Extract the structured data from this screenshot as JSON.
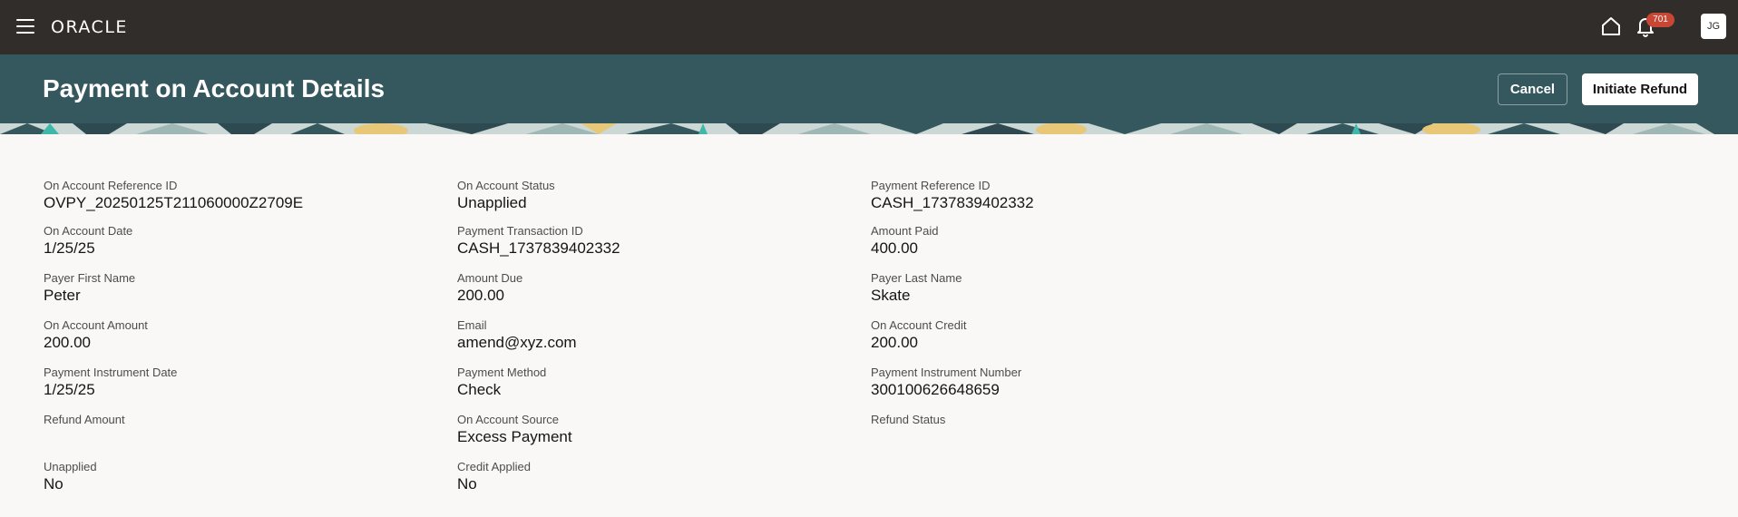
{
  "topbar": {
    "logo": "ORACLE",
    "notification_count": "701",
    "avatar_initials": "JG"
  },
  "header": {
    "title": "Payment on Account Details",
    "cancel_label": "Cancel",
    "refund_label": "Initiate Refund"
  },
  "details": {
    "col1": [
      {
        "label": "On Account Reference ID",
        "value": "OVPY_20250125T211060000Z2709E"
      },
      {
        "label": "On Account Date",
        "value": "1/25/25"
      },
      {
        "label": "Payer First Name",
        "value": "Peter"
      },
      {
        "label": "On Account Amount",
        "value": "200.00"
      },
      {
        "label": "Payment Instrument Date",
        "value": "1/25/25"
      },
      {
        "label": "Refund Amount",
        "value": ""
      },
      {
        "label": "Unapplied",
        "value": "No"
      }
    ],
    "col2": [
      {
        "label": "On Account Status",
        "value": "Unapplied"
      },
      {
        "label": "Payment Transaction ID",
        "value": "CASH_1737839402332"
      },
      {
        "label": "Amount Due",
        "value": "200.00"
      },
      {
        "label": "Email",
        "value": "amend@xyz.com"
      },
      {
        "label": "Payment Method",
        "value": "Check"
      },
      {
        "label": "On Account Source",
        "value": "Excess Payment"
      },
      {
        "label": "Credit Applied",
        "value": "No"
      }
    ],
    "col3": [
      {
        "label": "Payment Reference ID",
        "value": "CASH_1737839402332"
      },
      {
        "label": "Amount Paid",
        "value": "400.00"
      },
      {
        "label": "Payer Last Name",
        "value": "Skate"
      },
      {
        "label": "On Account Credit",
        "value": "200.00"
      },
      {
        "label": "Payment Instrument Number",
        "value": "300100626648659"
      },
      {
        "label": "Refund Status",
        "value": ""
      }
    ]
  },
  "colors": {
    "topbar": "#312d2a",
    "header": "#35575e",
    "badge": "#c74634",
    "page_background": "#f9f8f6"
  }
}
